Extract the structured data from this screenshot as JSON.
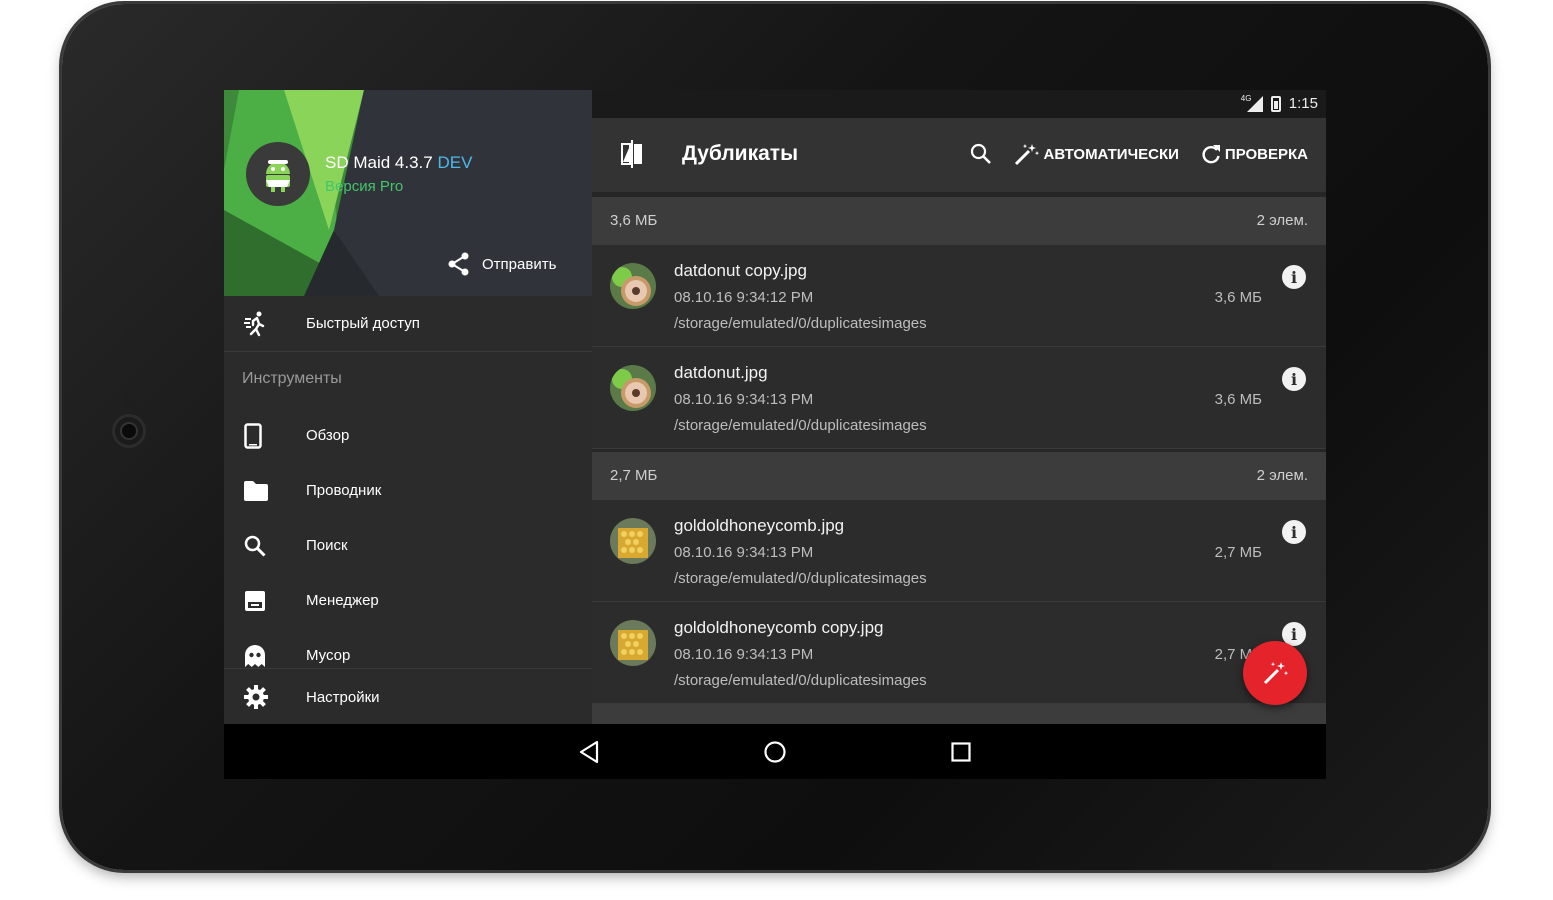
{
  "status_bar": {
    "network": "4G",
    "time": "1:15"
  },
  "drawer": {
    "app_name": "SD Maid 4.3.7",
    "app_tag": "DEV",
    "app_version": "Версия Pro",
    "share_label": "Отправить",
    "quick_access_label": "Быстрый доступ",
    "tools_section_label": "Инструменты",
    "tools": [
      {
        "label": "Обзор",
        "icon": "phone-icon"
      },
      {
        "label": "Проводник",
        "icon": "folder-icon"
      },
      {
        "label": "Поиск",
        "icon": "search-icon"
      },
      {
        "label": "Менеджер",
        "icon": "app-manager-icon"
      },
      {
        "label": "Мусор",
        "icon": "ghost-icon"
      }
    ],
    "settings_label": "Настройки"
  },
  "toolbar": {
    "title": "Дубликаты",
    "auto_label": "АВТОМАТИЧЕСКИ",
    "check_label": "ПРОВЕРКА"
  },
  "groups": [
    {
      "size": "3,6 МБ",
      "count": "2 элем.",
      "files": [
        {
          "name": "datdonut copy.jpg",
          "date": "08.10.16 9:34:12 PM",
          "path": "/storage/emulated/0/duplicatesimages",
          "size": "3,6 МБ"
        },
        {
          "name": "datdonut.jpg",
          "date": "08.10.16 9:34:13 PM",
          "path": "/storage/emulated/0/duplicatesimages",
          "size": "3,6 МБ"
        }
      ]
    },
    {
      "size": "2,7 МБ",
      "count": "2 элем.",
      "files": [
        {
          "name": "goldoldhoneycomb.jpg",
          "date": "08.10.16 9:34:13 PM",
          "path": "/storage/emulated/0/duplicatesimages",
          "size": "2,7 МБ"
        },
        {
          "name": "goldoldhoneycomb copy.jpg",
          "date": "08.10.16 9:34:13 PM",
          "path": "/storage/emulated/0/duplicatesimages",
          "size": "2,7 МБ"
        }
      ]
    }
  ],
  "colors": {
    "accent_green": "#43c56b",
    "dev_blue": "#4fb8e8",
    "fab_red": "#e4232b"
  }
}
